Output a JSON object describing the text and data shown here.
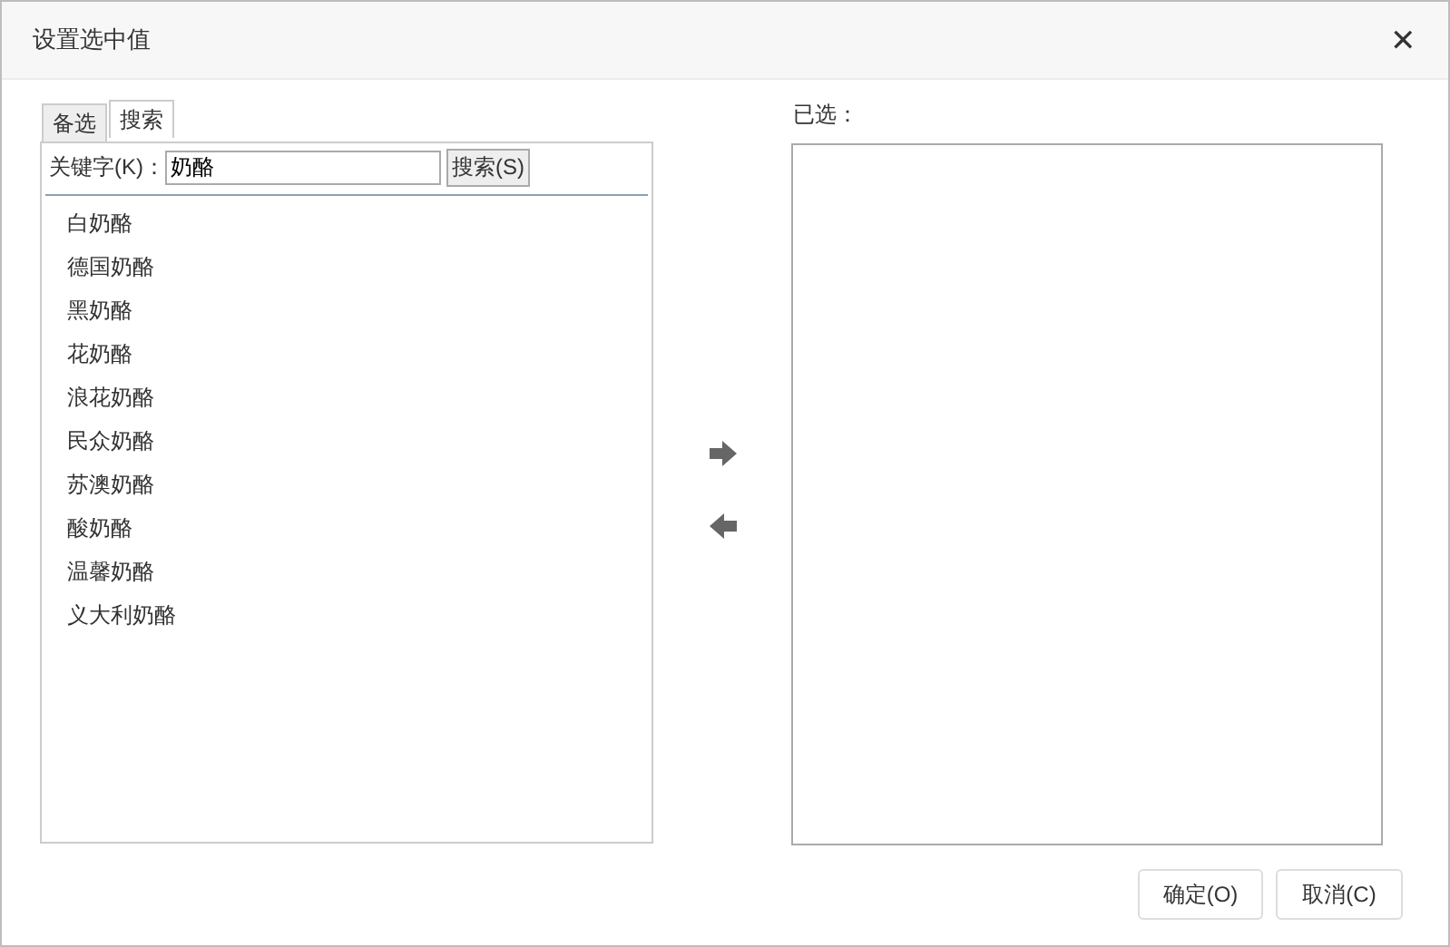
{
  "window": {
    "title": "设置选中值",
    "close": "✕"
  },
  "tabs": [
    {
      "label": "备选",
      "selected": false
    },
    {
      "label": "搜索",
      "selected": true
    }
  ],
  "search": {
    "label": "关键字(K)：",
    "value": "奶酪",
    "button": "搜索(S)"
  },
  "results": [
    {
      "label": "白奶酪"
    },
    {
      "label": "德国奶酪"
    },
    {
      "label": "黑奶酪"
    },
    {
      "label": "花奶酪"
    },
    {
      "label": "浪花奶酪"
    },
    {
      "label": "民众奶酪"
    },
    {
      "label": "苏澳奶酪"
    },
    {
      "label": "酸奶酪"
    },
    {
      "label": "温馨奶酪"
    },
    {
      "label": "义大利奶酪"
    }
  ],
  "selected_panel": {
    "label": "已选："
  },
  "buttons": [
    {
      "label": "确定(O)"
    },
    {
      "label": "取消(C)"
    }
  ]
}
